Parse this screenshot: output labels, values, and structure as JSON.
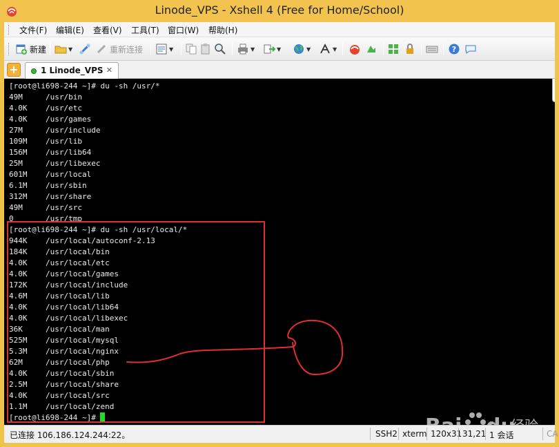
{
  "window": {
    "title": "Linode_VPS - Xshell 4 (Free for Home/School)"
  },
  "menu": [
    "文件(F)",
    "编辑(E)",
    "查看(V)",
    "工具(T)",
    "窗口(W)",
    "帮助(H)"
  ],
  "toolbar": {
    "new_label": "新建",
    "reconnect_label": "重新连接"
  },
  "tab": {
    "label": "1 Linode_VPS",
    "close": "✕",
    "add": "+"
  },
  "terminal": {
    "lines": [
      "[root@li698-244 ~]# du -sh /usr/*",
      "49M     /usr/bin",
      "4.0K    /usr/etc",
      "4.0K    /usr/games",
      "27M     /usr/include",
      "109M    /usr/lib",
      "156M    /usr/lib64",
      "25M     /usr/libexec",
      "601M    /usr/local",
      "6.1M    /usr/sbin",
      "312M    /usr/share",
      "49M     /usr/src",
      "0       /usr/tmp",
      "[root@li698-244 ~]# du -sh /usr/local/*",
      "944K    /usr/local/autoconf-2.13",
      "184K    /usr/local/bin",
      "4.0K    /usr/local/etc",
      "4.0K    /usr/local/games",
      "172K    /usr/local/include",
      "4.6M    /usr/local/lib",
      "4.0K    /usr/local/lib64",
      "4.0K    /usr/local/libexec",
      "36K     /usr/local/man",
      "525M    /usr/local/mysql",
      "5.3M    /usr/local/nginx",
      "62M     /usr/local/php",
      "4.0K    /usr/local/sbin",
      "2.5M    /usr/local/share",
      "4.0K    /usr/local/src",
      "1.1M    /usr/local/zend"
    ],
    "prompt": "[root@li698-244 ~]# "
  },
  "status": {
    "connection": "已连接 106.186.124.244:22。",
    "protocol": "SSH2",
    "term": "xterm",
    "size": "120x31",
    "cursor_pos": "31,21",
    "sessions": "1 会话",
    "caps": "CA"
  },
  "watermark": {
    "brand": "Bai",
    "brand2": "du",
    "suffix": "经验"
  },
  "colors": {
    "title_bg": "#f2c44f",
    "terminal_bg": "#000000",
    "terminal_fg": "#e8e8e8",
    "cursor": "#1fe01f",
    "highlight": "#e03030"
  }
}
